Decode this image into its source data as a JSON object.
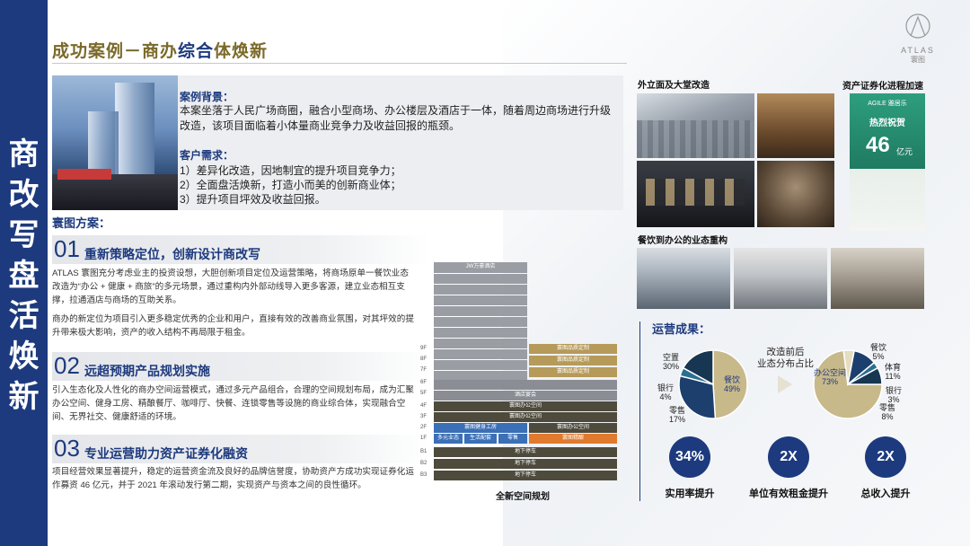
{
  "sidebar": {
    "title_chars": [
      "商",
      "改",
      "写",
      "盘",
      "活",
      "焕",
      "新"
    ]
  },
  "header": {
    "title_prefix": "成功案例－商办",
    "title_highlight": "综合",
    "title_suffix": "体焕新"
  },
  "logo": {
    "brand": "ATLAS",
    "sub": "寰图"
  },
  "case": {
    "background_label": "案例背景：",
    "background_text": "本案坐落于人民广场商圈，融合小型商场、办公楼层及酒店于一体，随着周边商场进行升级改造，该项目面临着小体量商业竞争力及收益回报的瓶颈。",
    "requirements_label": "客户需求：",
    "requirements": [
      "1）差异化改造，因地制宜的提升项目竞争力；",
      "2）全面盘活焕新，打造小而美的创新商业体；",
      "3）提升项目坪效及收益回报。"
    ]
  },
  "plan": {
    "label": "寰图方案：",
    "sections": [
      {
        "num": "01",
        "title": "重新策略定位，创新设计商改写",
        "paragraphs": [
          "ATLAS 寰图充分考虑业主的投资设想，大胆创新项目定位及运营策略，将商场原单一餐饮业态改造为“办公 + 健康 + 商旅”的多元场景，通过重构内外部动线导入更多客源，建立业态相互支撑，拉通酒店与商场的互助关系。",
          "商办的新定位为项目引入更多稳定优秀的企业和用户，直接有效的改善商业氛围，对其坪效的提升带来极大影响，资产的收入结构不再局限于租金。"
        ]
      },
      {
        "num": "02",
        "title": "远超预期产品规划实施",
        "paragraphs": [
          "引入生态化及人性化的商办空间运营模式，通过多元产品组合，合理的空间规划布局，成为汇聚办公空间、健身工房、精酿餐厅、咖啡厅、快餐、连锁零售等设施的商业综合体，实现融合空间、无界社交、健康舒适的环境。"
        ]
      },
      {
        "num": "03",
        "title": "专业运营助力资产证券化融资",
        "paragraphs": [
          "项目经营效果显著提升，稳定的运营资金流及良好的品牌信誉度，协助资产方成功实现证券化运作募资 46 亿元，并于 2021 年滚动发行第二期，实现资产与资本之间的良性循环。"
        ]
      }
    ]
  },
  "diagram": {
    "caption": "全新空间规划",
    "tower_label": "JW万豪酒店",
    "floor_labels": [
      "9F",
      "8F",
      "7F",
      "6F",
      "5F",
      "4F",
      "3F",
      "2F",
      "1F",
      "B1",
      "B2",
      "B3"
    ],
    "blocks": {
      "f9": "寰图品质定制",
      "f8": "寰图品质定制",
      "f7": "寰图品质定制",
      "f5": "酒店宴会",
      "f4": "寰图办公空间",
      "f3": "寰图办公空间",
      "f2a": "寰图健身工房",
      "f2b": "寰图办公空间",
      "f1a": "多元业态",
      "f1b": "生活配套",
      "f1c": "零售",
      "f1d": "寰图精酿",
      "b1": "地下停车",
      "b2": "地下停车",
      "b3": "地下停车"
    },
    "colors": {
      "gray": "#8a8d93",
      "dark": "#4e4a3c",
      "gold": "#b69a5a",
      "blue": "#3b6fb6",
      "orange": "#e07a2e"
    }
  },
  "photos": {
    "facade_caption": "外立面及大堂改造",
    "abs_caption": "资产证券化进程加速",
    "abs_poster": {
      "brand": "AGILE 雅居乐",
      "title": "热烈祝贺",
      "amount": "46",
      "unit": "亿元"
    },
    "fnb_caption": "餐饮到办公的业态重构"
  },
  "results": {
    "title": "运营成果：",
    "comparison_label": [
      "改造前后",
      "业态分布占比"
    ],
    "chart_data": [
      {
        "type": "pie",
        "name": "before",
        "labels": [
          "餐饮",
          "空置",
          "银行",
          "零售"
        ],
        "values": [
          49,
          30,
          4,
          17
        ],
        "colors": [
          "#c8b98a",
          "#1c3f6e",
          "#2b6f8f",
          "#173652"
        ]
      },
      {
        "type": "pie",
        "name": "after",
        "labels": [
          "办公空间",
          "餐饮",
          "体育",
          "银行",
          "零售"
        ],
        "values": [
          73,
          5,
          11,
          3,
          8
        ],
        "colors": [
          "#c8b98a",
          "#e6dcc0",
          "#1c3f6e",
          "#2b6f8f",
          "#173652"
        ]
      }
    ],
    "kpis": [
      {
        "value": "34%",
        "label": "实用率提升"
      },
      {
        "value": "2X",
        "label": "单位有效租金提升"
      },
      {
        "value": "2X",
        "label": "总收入提升"
      }
    ]
  }
}
